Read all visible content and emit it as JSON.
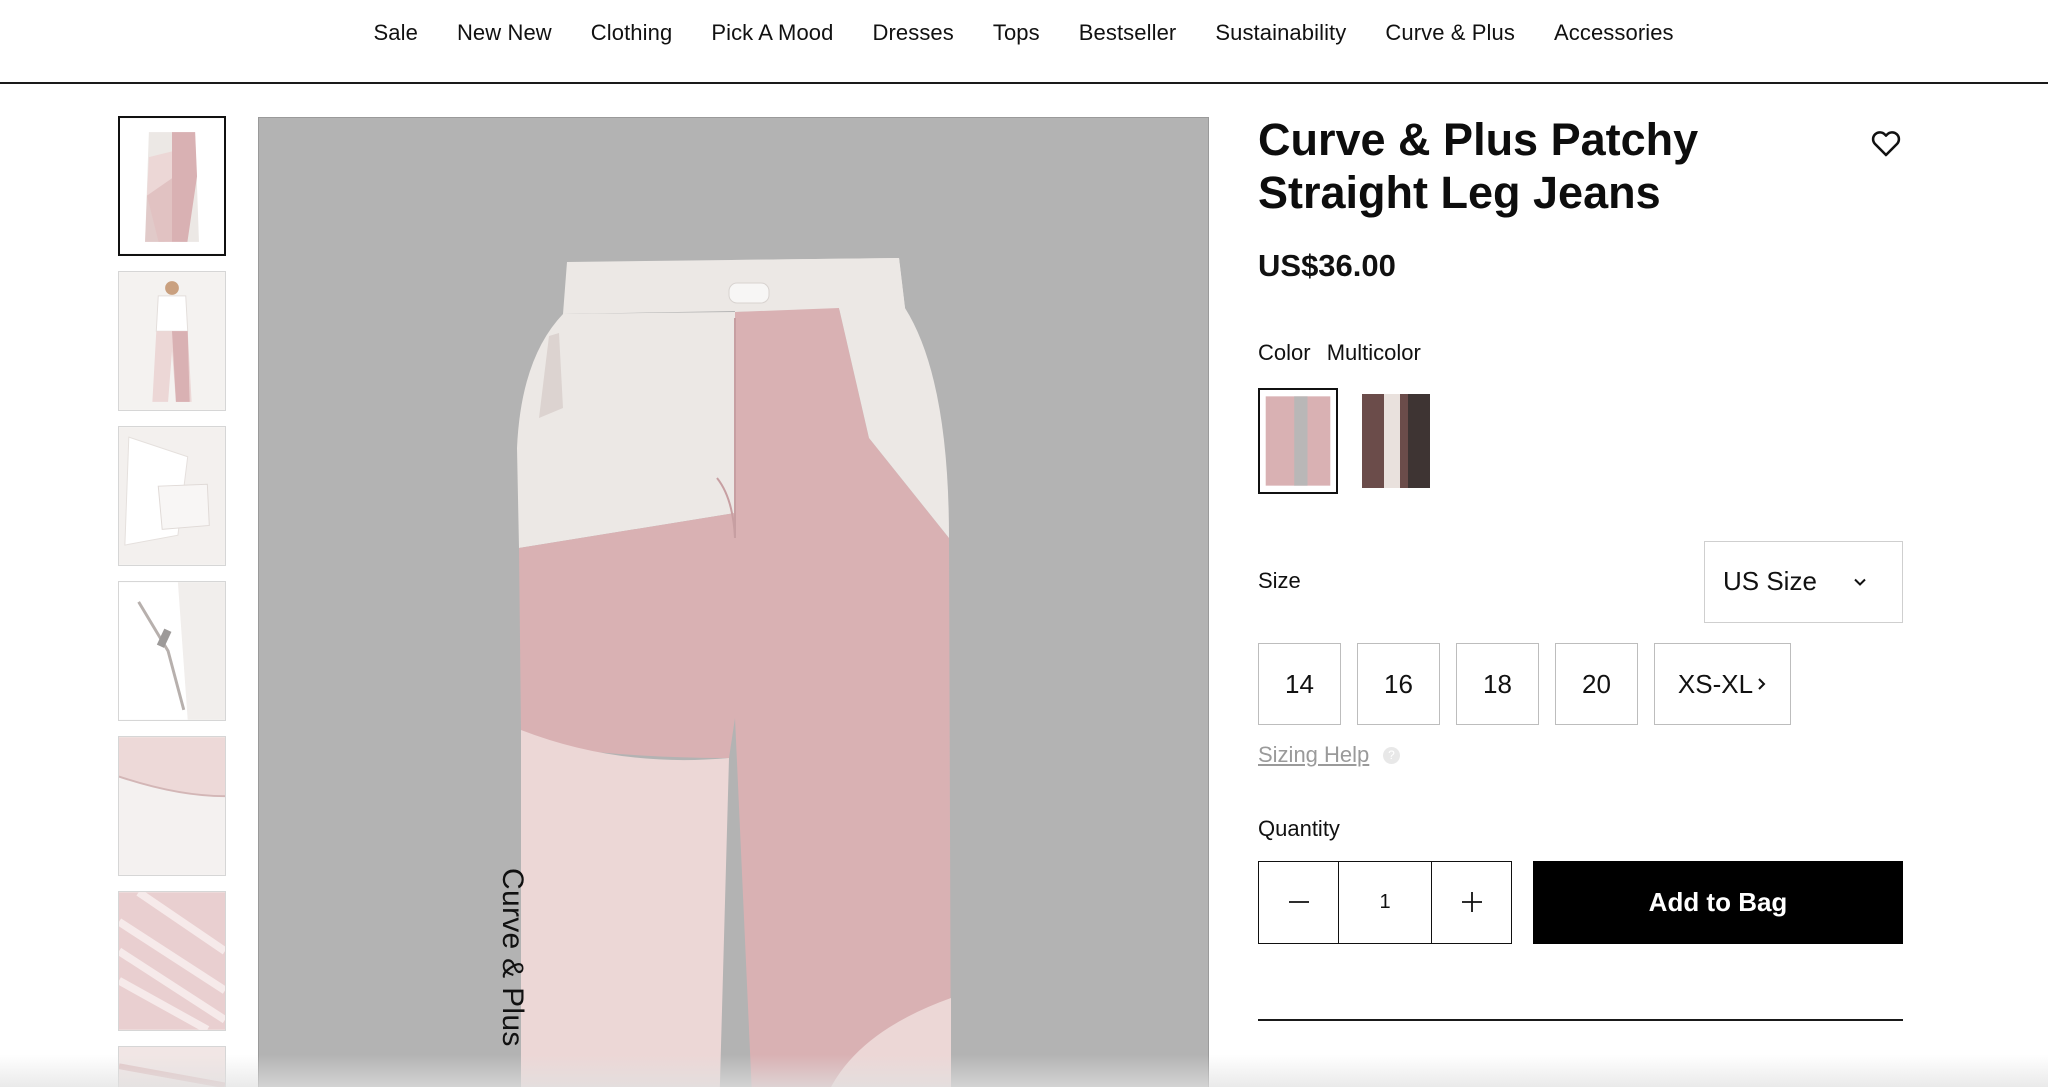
{
  "nav": {
    "items": [
      "Sale",
      "New New",
      "Clothing",
      "Pick A Mood",
      "Dresses",
      "Tops",
      "Bestseller",
      "Sustainability",
      "Curve & Plus",
      "Accessories"
    ]
  },
  "gallery": {
    "vertical_label": "Curve & Plus",
    "background_color": "#b3b3b3",
    "thumbnail_count": 7
  },
  "product": {
    "title": "Curve & Plus Patchy Straight Leg Jeans",
    "price": "US$36.00",
    "color_label": "Color",
    "color_value": "Multicolor",
    "size_label": "Size",
    "size_system": "US Size",
    "sizes": [
      "14",
      "16",
      "18",
      "20",
      "XS-XL"
    ],
    "sizing_help": "Sizing Help",
    "help_icon_text": "?",
    "quantity_label": "Quantity",
    "quantity": "1",
    "add_to_bag": "Add to Bag"
  },
  "colors": {
    "pink": "#d9b1b3",
    "light_pink": "#ecd7d6",
    "cream": "#ece8e5",
    "brown": "#6b4c4a",
    "cta_background": "#000000"
  }
}
